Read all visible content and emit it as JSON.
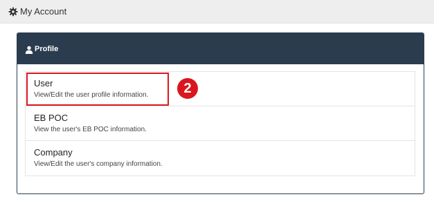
{
  "header": {
    "title": "My Account",
    "icon": "gear-icon"
  },
  "panel": {
    "title": "Profile",
    "icon": "user-icon",
    "header_color": "#2b3c4e",
    "items": [
      {
        "name": "User",
        "description": "View/Edit the user profile information."
      },
      {
        "name": "EB POC",
        "description": "View the user's EB POC information."
      },
      {
        "name": "Company",
        "description": "View/Edit the user's company information."
      }
    ]
  },
  "annotation": {
    "step_number": "2",
    "color": "#d9171e"
  }
}
